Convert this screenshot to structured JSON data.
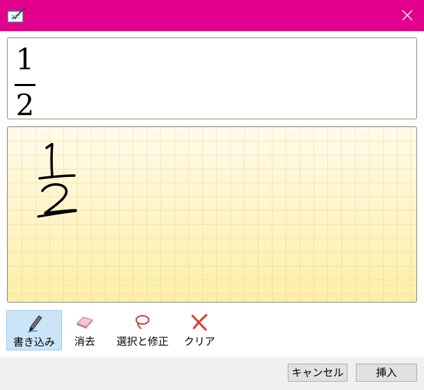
{
  "window": {
    "title": ""
  },
  "preview": {
    "numerator": "1",
    "denominator": "2"
  },
  "ink": {
    "strokes": "1/2"
  },
  "tools": [
    {
      "label": "書き込み",
      "icon": "pen-icon",
      "active": true
    },
    {
      "label": "消去",
      "icon": "eraser-icon",
      "active": false
    },
    {
      "label": "選択と修正",
      "icon": "lasso-icon",
      "active": false
    },
    {
      "label": "クリア",
      "icon": "clear-x-icon",
      "active": false
    }
  ],
  "buttons": {
    "cancel": "キャンセル",
    "insert": "挿入"
  },
  "colors": {
    "titlebar": "#e3008c",
    "ink_bg": "#fdf3c0",
    "active_tool": "#cce4f7",
    "clear_red": "#d83b2b"
  }
}
